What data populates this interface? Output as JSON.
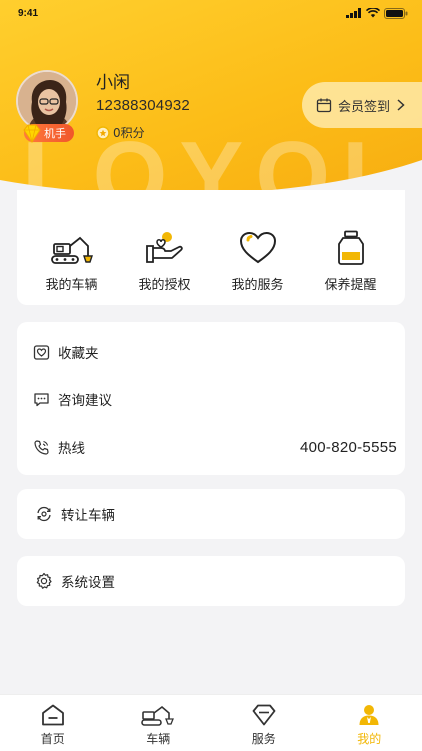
{
  "status_bar": {
    "time": "9:41"
  },
  "profile": {
    "name": "小闲",
    "phone": "12388304932",
    "points": "0积分",
    "level": "机手",
    "watermark": "LOYOL"
  },
  "signin": {
    "label": "会员签到"
  },
  "quick_actions": [
    {
      "label": "我的车辆",
      "icon": "excavator-icon"
    },
    {
      "label": "我的授权",
      "icon": "hand-heart-icon"
    },
    {
      "label": "我的服务",
      "icon": "heart-icon"
    },
    {
      "label": "保养提醒",
      "icon": "oil-bottle-icon"
    }
  ],
  "menu": [
    {
      "label": "收藏夹",
      "icon": "favorites-icon"
    },
    {
      "label": "咨询建议",
      "icon": "chat-icon"
    },
    {
      "label": "热线",
      "icon": "phone-icon",
      "value": "400-820-5555"
    }
  ],
  "transfer": {
    "label": "转让车辆"
  },
  "settings": {
    "label": "系统设置"
  },
  "tabbar": [
    {
      "label": "首页",
      "icon": "home-icon",
      "active": false
    },
    {
      "label": "车辆",
      "icon": "excavator-icon",
      "active": false
    },
    {
      "label": "服务",
      "icon": "diamond-icon",
      "active": false
    },
    {
      "label": "我的",
      "icon": "user-icon",
      "active": true
    }
  ],
  "colors": {
    "accent": "#f2b705",
    "header_start": "#ffcf2e",
    "header_end": "#f7ac10",
    "badge": "#f0562a"
  }
}
